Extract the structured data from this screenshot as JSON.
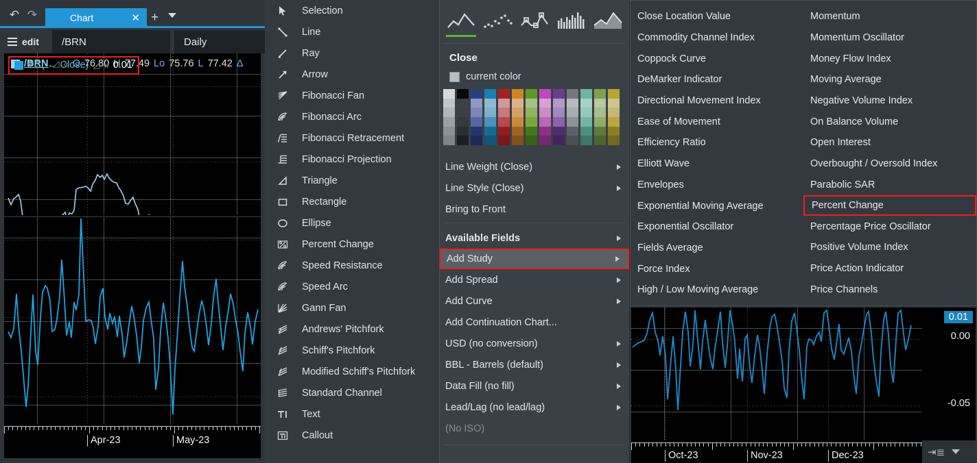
{
  "app": {
    "tab_label": "Chart",
    "undo_icon": "undo-arrow-icon",
    "redo_icon": "redo-arrow-icon",
    "close_icon": "✕",
    "add_tab_icon": "+",
    "tab_menu_icon": "chevron-down-icon"
  },
  "toolbar": {
    "edit_label": "edit",
    "symbol_value": "/BRN",
    "interval_value": "Daily"
  },
  "quote": {
    "symbol": "/BRN",
    "fields": [
      {
        "label": "O",
        "value": "76.80"
      },
      {
        "label": "H",
        "value": "77.49"
      },
      {
        "label": "Lo",
        "value": "75.76"
      },
      {
        "label": "L",
        "value": "77.42"
      }
    ],
    "delta_symbol": "Δ"
  },
  "study_legend": {
    "text": "PC( ← Close)",
    "value": "0.01",
    "highlight_color": "#f41c1c"
  },
  "left_axis": {
    "labels": [
      "Apr-23",
      "May-23"
    ]
  },
  "tools": {
    "items": [
      {
        "label": "Selection",
        "icon": "cursor-arrow-icon"
      },
      {
        "label": "Line",
        "icon": "line-icon"
      },
      {
        "label": "Ray",
        "icon": "ray-icon"
      },
      {
        "label": "Arrow",
        "icon": "arrow-icon"
      },
      {
        "label": "Fibonacci Fan",
        "icon": "fibonacci-fan-icon"
      },
      {
        "label": "Fibonacci Arc",
        "icon": "fibonacci-arc-icon"
      },
      {
        "label": "Fibonacci Retracement",
        "icon": "fibonacci-retracement-icon"
      },
      {
        "label": "Fibonacci Projection",
        "icon": "fibonacci-projection-icon"
      },
      {
        "label": "Triangle",
        "icon": "triangle-icon"
      },
      {
        "label": "Rectangle",
        "icon": "rectangle-icon"
      },
      {
        "label": "Ellipse",
        "icon": "ellipse-icon"
      },
      {
        "label": "Percent Change",
        "icon": "percent-change-icon"
      },
      {
        "label": "Speed Resistance",
        "icon": "speed-resistance-icon"
      },
      {
        "label": "Speed Arc",
        "icon": "speed-arc-icon"
      },
      {
        "label": "Gann Fan",
        "icon": "gann-fan-icon"
      },
      {
        "label": "Andrews' Pitchfork",
        "icon": "andrews-pitchfork-icon"
      },
      {
        "label": "Schiff's Pitchfork",
        "icon": "schiff-pitchfork-icon"
      },
      {
        "label": "Modified Schiff's Pitchfork",
        "icon": "modified-schiff-pitchfork-icon"
      },
      {
        "label": "Standard Channel",
        "icon": "standard-channel-icon"
      },
      {
        "label": "Text",
        "icon": "text-icon"
      },
      {
        "label": "Callout",
        "icon": "callout-icon"
      }
    ]
  },
  "context_menu": {
    "chart_types": [
      {
        "name": "line-chart-type",
        "selected": true
      },
      {
        "name": "dot-chart-type",
        "selected": false
      },
      {
        "name": "step-marker-chart-type",
        "selected": false
      },
      {
        "name": "bar-chart-type",
        "selected": false
      },
      {
        "name": "area-chart-type",
        "selected": false
      }
    ],
    "title": "Close",
    "current_color_label": "current color",
    "palette_colors": [
      [
        "#d5d9dc",
        "#c1c6ca",
        "#b0b6ba",
        "#9ba2a7",
        "#8b9197",
        "#7e858b"
      ],
      [
        "#07090b",
        "#3b4247",
        "#3a4146",
        "#333a3f",
        "#282e32",
        "#191f23"
      ],
      [
        "#29407a",
        "#8e98c4",
        "#7c87b8",
        "#5a66a3",
        "#23356a",
        "#1b2a57"
      ],
      [
        "#1b7fb0",
        "#8fb9d2",
        "#7db0cd",
        "#4a91bb",
        "#166a94",
        "#12557a"
      ],
      [
        "#a81f22",
        "#cf9a9c",
        "#c8797c",
        "#b9494d",
        "#931c1f",
        "#7a1719"
      ],
      [
        "#cf8423",
        "#d9b288",
        "#d5a067",
        "#c88a3e",
        "#9c6420",
        "#80521a"
      ],
      [
        "#5b9a22",
        "#a6c086",
        "#92b565",
        "#7aa73f",
        "#44761a",
        "#396215"
      ],
      [
        "#c246bd",
        "#d9a0d4",
        "#cd8cc8",
        "#b968b4",
        "#8e2f8a",
        "#762872"
      ],
      [
        "#6b3d92",
        "#b19ac8",
        "#a188bd",
        "#8a63ab",
        "#512d6f",
        "#43255c"
      ],
      [
        "#73797e",
        "#b7bbbe",
        "#a8adb0",
        "#8d9296",
        "#5c6165",
        "#4b5053"
      ],
      [
        "#6fb6a2",
        "#a8d1c6",
        "#96c8ba",
        "#73b5a4",
        "#4d8f7e",
        "#3f7668"
      ],
      [
        "#7fa04e",
        "#b7c9a0",
        "#a9bf8b",
        "#90ae68",
        "#5d7a39",
        "#4d652f"
      ],
      [
        "#b9a72f",
        "#cfc490",
        "#c6b975",
        "#b7a73e",
        "#8b7d23",
        "#73681d"
      ]
    ],
    "items": [
      {
        "label": "Line Weight (Close)",
        "submenu": true,
        "style": "normal"
      },
      {
        "label": "Line Style (Close)",
        "submenu": true,
        "style": "normal"
      },
      {
        "label": "Bring to Front",
        "submenu": false,
        "style": "normal"
      },
      {
        "label": "Available Fields",
        "submenu": true,
        "style": "bold"
      },
      {
        "label": "Add Study",
        "submenu": true,
        "style": "highlighted"
      },
      {
        "label": "Add Spread",
        "submenu": true,
        "style": "normal"
      },
      {
        "label": "Add Curve",
        "submenu": true,
        "style": "normal"
      },
      {
        "label": "Add Continuation Chart...",
        "submenu": false,
        "style": "normal"
      },
      {
        "label": "USD (no conversion)",
        "submenu": true,
        "style": "normal"
      },
      {
        "label": "BBL - Barrels (default)",
        "submenu": true,
        "style": "normal"
      },
      {
        "label": "Data Fill (no fill)",
        "submenu": true,
        "style": "normal"
      },
      {
        "label": "Lead/Lag (no lead/lag)",
        "submenu": true,
        "style": "normal"
      },
      {
        "label": "(No ISO)",
        "submenu": false,
        "style": "disabled"
      }
    ]
  },
  "study_list": {
    "left_column": [
      "Close Location Value",
      "Commodity Channel Index",
      "Coppock Curve",
      "DeMarker Indicator",
      "Directional Movement Index",
      "Ease of Movement",
      "Efficiency Ratio",
      "Elliott Wave",
      "Envelopes",
      "Exponential Moving Average",
      "Exponential Oscillator",
      "Fields Average",
      "Force Index",
      "High / Low Moving Average"
    ],
    "right_column": [
      "Momentum",
      "Momentum Oscillator",
      "Money Flow Index",
      "Moving Average",
      "Negative Volume Index",
      "On Balance Volume",
      "Open Interest",
      "Overbought / Oversold Index",
      "Parabolic SAR",
      "Percent Change",
      "Percentage Price Oscillator",
      "Positive Volume Index",
      "Price Action Indicator",
      "Price Channels"
    ],
    "highlighted_item": "Percent Change"
  },
  "right_chart": {
    "value_tag": "0.01",
    "axis_labels": [
      "0.00",
      "-0.05"
    ],
    "x_labels": [
      "Oct-23",
      "Nov-23",
      "Dec-23"
    ],
    "fit_icon": "fit-data-icon",
    "caret_icon": "chevron-down-icon"
  },
  "colors": {
    "accent": "#2196d6",
    "highlight": "#f41c1c",
    "series_price": "#9fd5ef",
    "series_study": "#1da3e0",
    "panel_bg": "#333a3f",
    "menu_bg": "#3a4146",
    "chart_bg": "#000000"
  }
}
